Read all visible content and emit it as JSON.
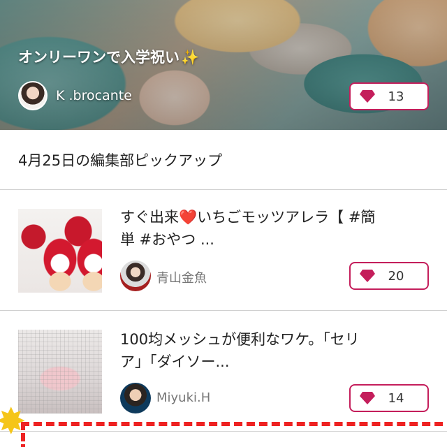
{
  "hero": {
    "title": "オンリーワンで入学祝い",
    "title_emoji": "✨",
    "author": "K .brocante",
    "like_count": "13"
  },
  "section": {
    "heading": "4月25日の編集部ピックアップ"
  },
  "articles": [
    {
      "title_line1_a": "すぐ出来",
      "title_heart": "❤️",
      "title_line1_b": "いちごモッツアレラ【 #簡",
      "title_line2": "単 #おやつ ...",
      "author": "青山金魚",
      "like_count": "20"
    },
    {
      "title_line1": "100均メッシュが便利なワケ。「セリ",
      "title_line2": "ア」「ダイソー...",
      "author": "Miyuki.H",
      "like_count": "14"
    }
  ],
  "colors": {
    "accent": "#c41e5b",
    "divider": "#d0d0d0",
    "banner_red": "#ee2222"
  },
  "icons": {
    "like": "gem-icon",
    "decoration": "star-icon"
  }
}
